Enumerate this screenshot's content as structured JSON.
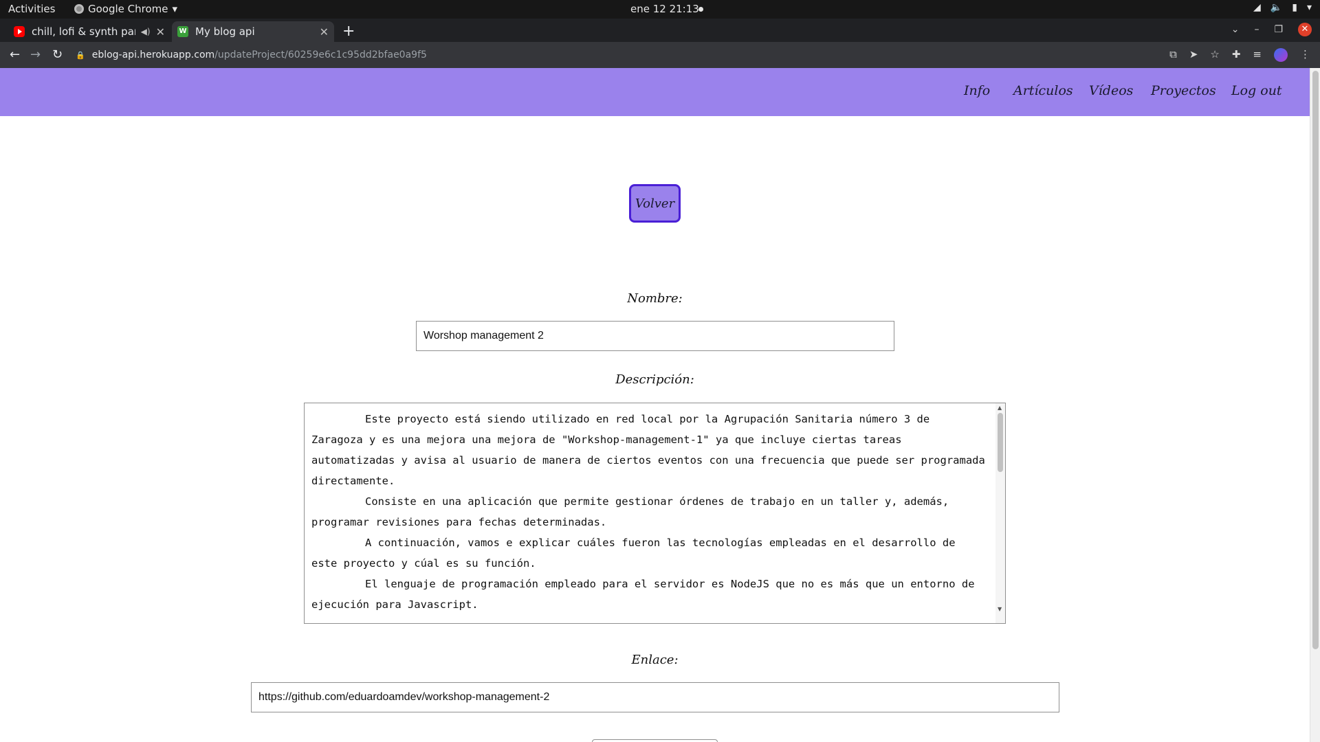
{
  "os_bar": {
    "activities": "Activities",
    "app_name": "Google Chrome",
    "clock": "ene 12  21:13"
  },
  "browser": {
    "tabs": [
      {
        "title": "chill, lofi & synth para p",
        "favicon": "youtube-icon",
        "audio": true
      },
      {
        "title": "My blog api",
        "favicon": "w-icon",
        "active": true
      }
    ],
    "url_host": "eblog-api.herokuapp.com",
    "url_path": "/updateProject/60259e6c1c95dd2bfae0a9f5"
  },
  "nav": {
    "links": [
      "Info",
      "Artículos",
      "Vídeos",
      "Proyectos",
      "Log out"
    ]
  },
  "page": {
    "back_button": "Volver",
    "name_label": "Nombre:",
    "name_value": "Worshop management 2",
    "description_label": "Descripción:",
    "description_paragraphs": [
      "Este proyecto está siendo utilizado en red local por la Agrupación Sanitaria número 3 de Zaragoza y es una mejora una mejora de \"Workshop-management-1\" ya que incluye ciertas tareas automatizadas y avisa al usuario de manera de ciertos eventos con una frecuencia que puede ser programada directamente.",
      "Consiste en una aplicación que permite gestionar órdenes de trabajo en un taller y, además, programar revisiones para fechas determinadas.",
      "A continuación, vamos e explicar cuáles fueron las tecnologías empleadas en el desarrollo de este proyecto y cúal es su función.",
      "El lenguaje de programación empleado para el servidor es NodeJS que no es más que un entorno de ejecución para Javascript."
    ],
    "link_label": "Enlace:",
    "link_value": "https://github.com/eduardoamdev/workshop-management-2"
  },
  "colors": {
    "navbar_bg": "#9a82ec",
    "button_border": "#4a1fd6"
  }
}
